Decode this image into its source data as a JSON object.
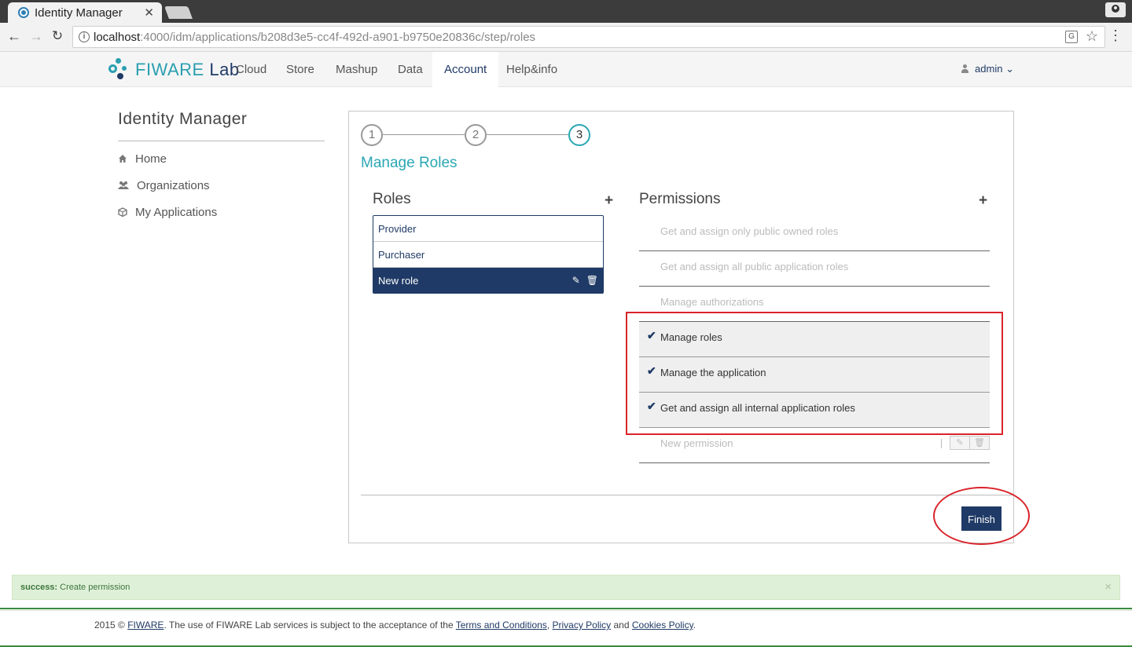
{
  "browser": {
    "tab_title": "Identity Manager",
    "tab_close": "✕",
    "url_host": "localhost",
    "url_path": ":4000/idm/applications/b208d3e5-cc4f-492d-a901-b9750e20836c/step/roles"
  },
  "navbar": {
    "logo_main": "FIWARE",
    "logo_sub": "Lab",
    "items": [
      "Cloud",
      "Store",
      "Mashup",
      "Data",
      "Account",
      "Help&info"
    ],
    "active_item": "Account",
    "user": "admin",
    "user_caret": "⌄"
  },
  "sidebar": {
    "title": "Identity Manager",
    "items": [
      {
        "label": "Home",
        "icon": "home-icon"
      },
      {
        "label": "Organizations",
        "icon": "group-icon"
      },
      {
        "label": "My Applications",
        "icon": "cube-icon"
      }
    ]
  },
  "wizard": {
    "steps": [
      "1",
      "2",
      "3"
    ],
    "current_step": "3",
    "title": "Manage Roles"
  },
  "roles": {
    "title": "Roles",
    "add": "+",
    "items": [
      "Provider",
      "Purchaser",
      "New role"
    ],
    "selected": "New role"
  },
  "permissions": {
    "title": "Permissions",
    "add": "+",
    "items": [
      {
        "label": "Get and assign only public owned roles",
        "checked": false
      },
      {
        "label": "Get and assign all public application roles",
        "checked": false
      },
      {
        "label": "Manage authorizations",
        "checked": false
      },
      {
        "label": "Manage roles",
        "checked": true
      },
      {
        "label": "Manage the application",
        "checked": true
      },
      {
        "label": "Get and assign all internal application roles",
        "checked": true
      },
      {
        "label": "New permission",
        "checked": false
      }
    ]
  },
  "finish_label": "Finish",
  "alert": {
    "level": "success:",
    "message": "Create permission",
    "close": "×"
  },
  "footer": {
    "prefix": "2015 © ",
    "fiware": "FIWARE",
    "middle": ". The use of FIWARE Lab services is subject to the acceptance of the ",
    "terms": "Terms and Conditions",
    "comma": ", ",
    "privacy": "Privacy Policy",
    "and": " and ",
    "cookies": "Cookies Policy",
    "end": "."
  },
  "colors": {
    "brand_navy": "#1f3a66",
    "brand_teal": "#2aa7b3",
    "highlight_red": "#d9242a",
    "alert_green_bg": "#dff0d8"
  }
}
